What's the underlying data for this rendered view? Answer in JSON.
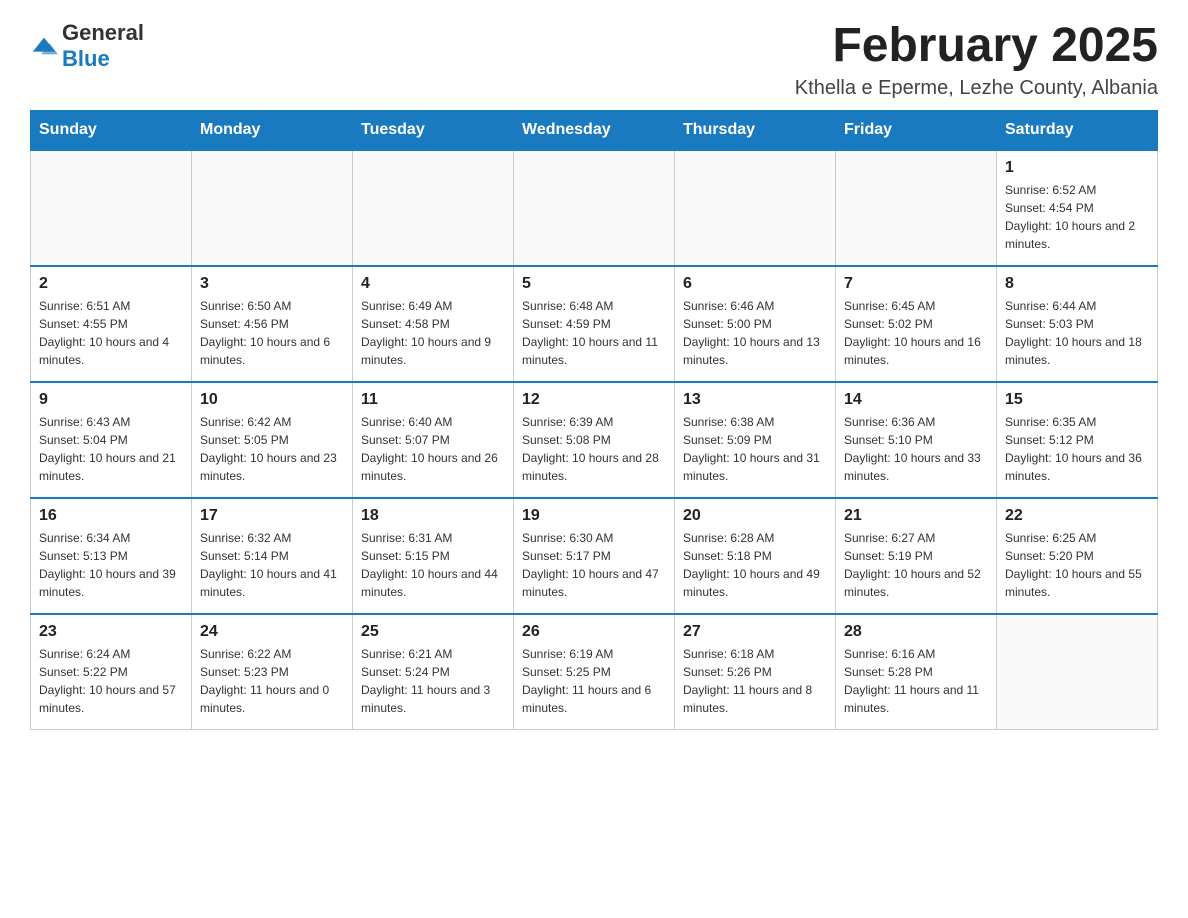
{
  "header": {
    "logo": {
      "general": "General",
      "blue": "Blue"
    },
    "title": "February 2025",
    "subtitle": "Kthella e Eperme, Lezhe County, Albania"
  },
  "calendar": {
    "days_of_week": [
      "Sunday",
      "Monday",
      "Tuesday",
      "Wednesday",
      "Thursday",
      "Friday",
      "Saturday"
    ],
    "weeks": [
      [
        {
          "day": "",
          "info": ""
        },
        {
          "day": "",
          "info": ""
        },
        {
          "day": "",
          "info": ""
        },
        {
          "day": "",
          "info": ""
        },
        {
          "day": "",
          "info": ""
        },
        {
          "day": "",
          "info": ""
        },
        {
          "day": "1",
          "info": "Sunrise: 6:52 AM\nSunset: 4:54 PM\nDaylight: 10 hours and 2 minutes."
        }
      ],
      [
        {
          "day": "2",
          "info": "Sunrise: 6:51 AM\nSunset: 4:55 PM\nDaylight: 10 hours and 4 minutes."
        },
        {
          "day": "3",
          "info": "Sunrise: 6:50 AM\nSunset: 4:56 PM\nDaylight: 10 hours and 6 minutes."
        },
        {
          "day": "4",
          "info": "Sunrise: 6:49 AM\nSunset: 4:58 PM\nDaylight: 10 hours and 9 minutes."
        },
        {
          "day": "5",
          "info": "Sunrise: 6:48 AM\nSunset: 4:59 PM\nDaylight: 10 hours and 11 minutes."
        },
        {
          "day": "6",
          "info": "Sunrise: 6:46 AM\nSunset: 5:00 PM\nDaylight: 10 hours and 13 minutes."
        },
        {
          "day": "7",
          "info": "Sunrise: 6:45 AM\nSunset: 5:02 PM\nDaylight: 10 hours and 16 minutes."
        },
        {
          "day": "8",
          "info": "Sunrise: 6:44 AM\nSunset: 5:03 PM\nDaylight: 10 hours and 18 minutes."
        }
      ],
      [
        {
          "day": "9",
          "info": "Sunrise: 6:43 AM\nSunset: 5:04 PM\nDaylight: 10 hours and 21 minutes."
        },
        {
          "day": "10",
          "info": "Sunrise: 6:42 AM\nSunset: 5:05 PM\nDaylight: 10 hours and 23 minutes."
        },
        {
          "day": "11",
          "info": "Sunrise: 6:40 AM\nSunset: 5:07 PM\nDaylight: 10 hours and 26 minutes."
        },
        {
          "day": "12",
          "info": "Sunrise: 6:39 AM\nSunset: 5:08 PM\nDaylight: 10 hours and 28 minutes."
        },
        {
          "day": "13",
          "info": "Sunrise: 6:38 AM\nSunset: 5:09 PM\nDaylight: 10 hours and 31 minutes."
        },
        {
          "day": "14",
          "info": "Sunrise: 6:36 AM\nSunset: 5:10 PM\nDaylight: 10 hours and 33 minutes."
        },
        {
          "day": "15",
          "info": "Sunrise: 6:35 AM\nSunset: 5:12 PM\nDaylight: 10 hours and 36 minutes."
        }
      ],
      [
        {
          "day": "16",
          "info": "Sunrise: 6:34 AM\nSunset: 5:13 PM\nDaylight: 10 hours and 39 minutes."
        },
        {
          "day": "17",
          "info": "Sunrise: 6:32 AM\nSunset: 5:14 PM\nDaylight: 10 hours and 41 minutes."
        },
        {
          "day": "18",
          "info": "Sunrise: 6:31 AM\nSunset: 5:15 PM\nDaylight: 10 hours and 44 minutes."
        },
        {
          "day": "19",
          "info": "Sunrise: 6:30 AM\nSunset: 5:17 PM\nDaylight: 10 hours and 47 minutes."
        },
        {
          "day": "20",
          "info": "Sunrise: 6:28 AM\nSunset: 5:18 PM\nDaylight: 10 hours and 49 minutes."
        },
        {
          "day": "21",
          "info": "Sunrise: 6:27 AM\nSunset: 5:19 PM\nDaylight: 10 hours and 52 minutes."
        },
        {
          "day": "22",
          "info": "Sunrise: 6:25 AM\nSunset: 5:20 PM\nDaylight: 10 hours and 55 minutes."
        }
      ],
      [
        {
          "day": "23",
          "info": "Sunrise: 6:24 AM\nSunset: 5:22 PM\nDaylight: 10 hours and 57 minutes."
        },
        {
          "day": "24",
          "info": "Sunrise: 6:22 AM\nSunset: 5:23 PM\nDaylight: 11 hours and 0 minutes."
        },
        {
          "day": "25",
          "info": "Sunrise: 6:21 AM\nSunset: 5:24 PM\nDaylight: 11 hours and 3 minutes."
        },
        {
          "day": "26",
          "info": "Sunrise: 6:19 AM\nSunset: 5:25 PM\nDaylight: 11 hours and 6 minutes."
        },
        {
          "day": "27",
          "info": "Sunrise: 6:18 AM\nSunset: 5:26 PM\nDaylight: 11 hours and 8 minutes."
        },
        {
          "day": "28",
          "info": "Sunrise: 6:16 AM\nSunset: 5:28 PM\nDaylight: 11 hours and 11 minutes."
        },
        {
          "day": "",
          "info": ""
        }
      ]
    ]
  }
}
